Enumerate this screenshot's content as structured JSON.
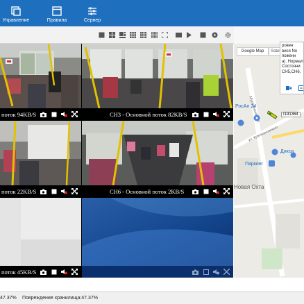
{
  "ribbon": {
    "items": [
      {
        "label": "Управление",
        "icon": "management-icon"
      },
      {
        "label": "Правила",
        "icon": "rules-icon"
      },
      {
        "label": "Сервер",
        "icon": "server-icon"
      }
    ],
    "color": "#1f6fbf"
  },
  "video": {
    "cells": [
      {
        "caption": "поток 94KB/S",
        "status": "active"
      },
      {
        "caption": "CH3 - Основной поток 82KB/S",
        "status": "active"
      },
      {
        "caption": "поток 22KB/S",
        "status": "active"
      },
      {
        "caption": "CH6 - Основной поток 2KB/S",
        "status": "active"
      },
      {
        "caption": "поток 45KB/S",
        "status": "active"
      },
      {
        "caption": "",
        "status": "no-signal"
      }
    ]
  },
  "map": {
    "map_button": "Google Map",
    "satellite_button": "Satellite",
    "popup_lines": [
      "ровен",
      "вися No",
      "поженн",
      "a). Нормал",
      "Состояни",
      "CH5,CH6,"
    ],
    "vehicle_id": "I191364",
    "labels": {
      "street1": "Мурманская ул.",
      "poi1": "РосАл 24",
      "street2": "ул. Кржижановского",
      "store": "Дикси",
      "parking": "Паркинг",
      "district": "Новая Охта"
    }
  },
  "status": {
    "left": "47.37%",
    "storage": "Повреждение хранилища:47.37%"
  }
}
